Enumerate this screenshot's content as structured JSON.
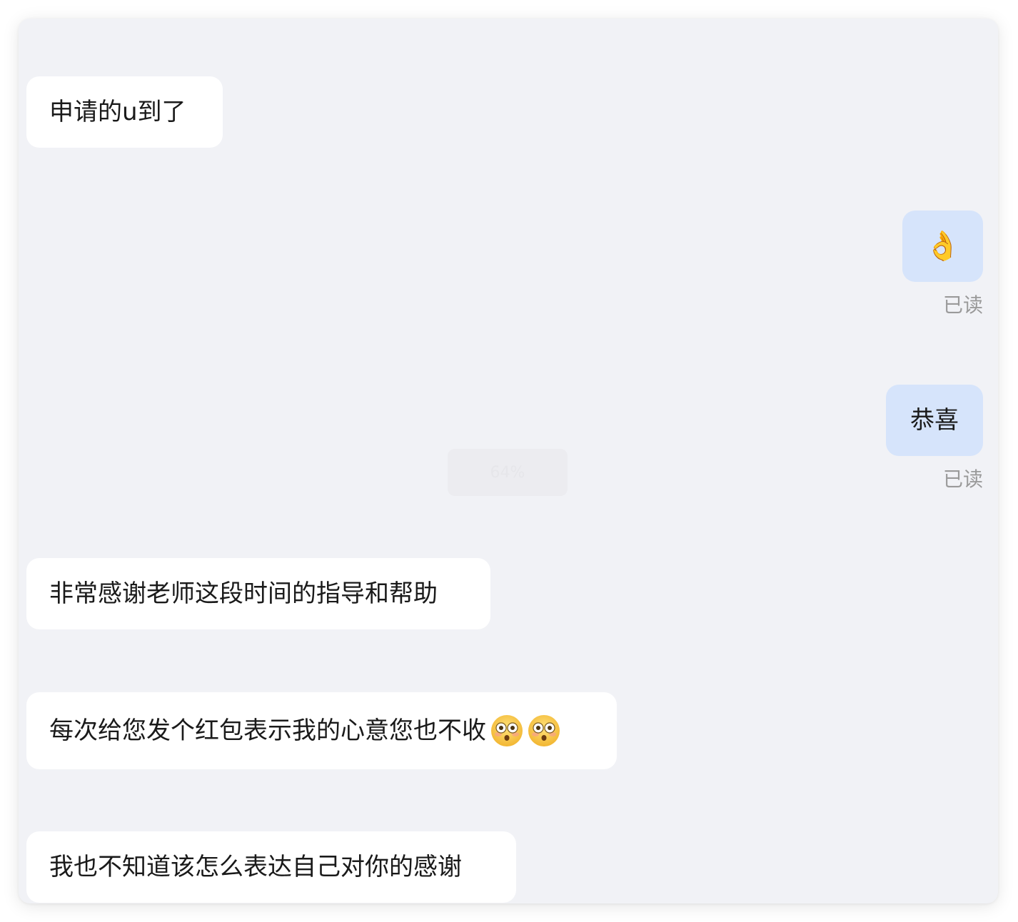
{
  "messages": [
    {
      "text": "申请的u到了"
    },
    {
      "emoji": "👌",
      "emoji_name": "ok-hand-icon",
      "status": "已读"
    },
    {
      "text": "恭喜",
      "status": "已读"
    },
    {
      "text": "非常感谢老师这段时间的指导和帮助"
    },
    {
      "text": "每次给您发个红包表示我的心意您也不收",
      "emoji_name": "flushed-face-icon"
    },
    {
      "text": "我也不知道该怎么表达自己对你的感谢"
    }
  ],
  "progress": {
    "value": 0.64,
    "label": "64%"
  },
  "colors": {
    "panel_bg": "#f1f2f6",
    "incoming_bubble": "#ffffff",
    "outgoing_bubble": "#d6e4fb",
    "status_text": "#9a9a9a"
  }
}
